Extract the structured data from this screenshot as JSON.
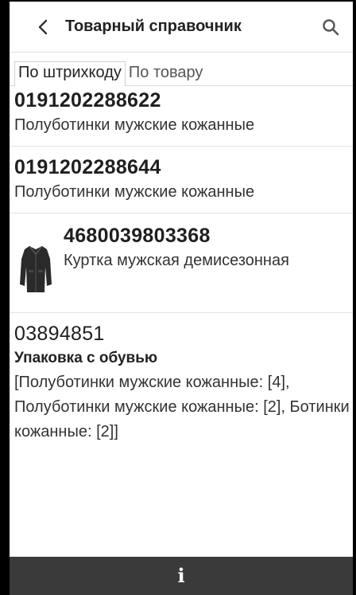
{
  "header": {
    "title": "Товарный справочник",
    "back_icon": "chevron-left-icon",
    "search_icon": "search-icon"
  },
  "tabs": [
    {
      "label": "По штрихкоду",
      "active": true
    },
    {
      "label": "По товару",
      "active": false
    }
  ],
  "items": [
    {
      "code": "0191202288622",
      "name": "Полуботинки мужские кожанные"
    },
    {
      "code": "0191202288644",
      "name": "Полуботинки мужские кожанные"
    },
    {
      "code": "4680039803368",
      "name": "Куртка мужская демисезонная",
      "image_icon": "jacket-thumbnail-icon"
    },
    {
      "code": "03894851",
      "title": "Упаковка с обувью",
      "description": "[Полуботинки мужские кожанные: [4], Полуботинки мужские кожанные: [2], Ботинки кожанные: [2]]"
    }
  ],
  "bottom_bar": {
    "icon": "info-icon",
    "label": "i",
    "background": "#3a3a3a"
  }
}
